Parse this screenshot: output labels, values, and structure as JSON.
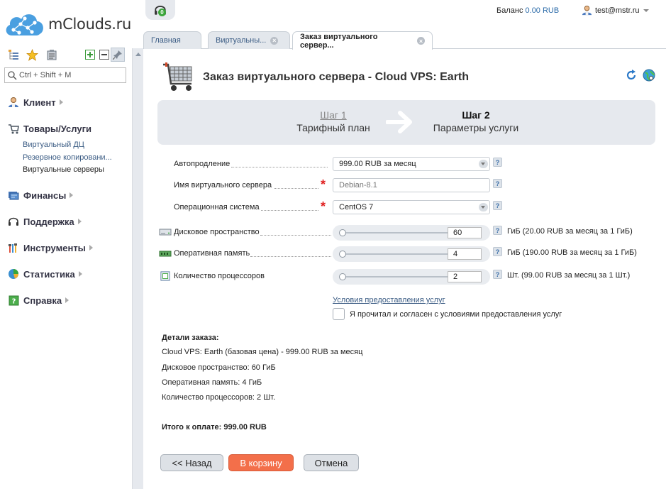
{
  "brand": {
    "logo_text": "mClouds.ru"
  },
  "search": {
    "placeholder": "Ctrl + Shift + M"
  },
  "topbar": {
    "headset_badge": "0",
    "balance_label": "Баланс",
    "balance_value": "0.00 RUB",
    "user": "test@mstr.ru"
  },
  "nav": {
    "client": "Клиент",
    "goods": "Товары/Услуги",
    "goods_sub": [
      "Виртуальный ДЦ",
      "Резервное копировани...",
      "Виртуальные серверы"
    ],
    "finance": "Финансы",
    "support": "Поддержка",
    "tools": "Инструменты",
    "stats": "Статистика",
    "help": "Справка"
  },
  "tabs": {
    "home": "Главная",
    "virtual": "Виртуальны...",
    "order": "Заказ виртуального сервер..."
  },
  "page": {
    "title": "Заказ виртуального сервера - Cloud VPS: Earth"
  },
  "steps": {
    "step1_title": "Шаг 1",
    "step1_sub": "Тарифный план",
    "step2_title": "Шаг 2",
    "step2_sub": "Параметры услуги"
  },
  "form": {
    "autorenew_label": "Автопродление",
    "autorenew_value": "999.00 RUB за месяц",
    "name_label": "Имя виртуального сервера",
    "name_placeholder": "Debian-8.1",
    "os_label": "Операционная система",
    "os_value": "CentOS 7",
    "disk_label": "Дисковое пространство",
    "disk_value": "60",
    "disk_unit": "ГиБ (20.00 RUB за месяц за 1 ГиБ)",
    "ram_label": "Оперативная память",
    "ram_value": "4",
    "ram_unit": "ГиБ (190.00 RUB за месяц за 1 ГиБ)",
    "cpu_label": "Количество процессоров",
    "cpu_value": "2",
    "cpu_unit": "Шт. (99.00 RUB за месяц за 1 Шт.)",
    "help_mark": "?",
    "required_mark": "*"
  },
  "terms": {
    "link": "Условия предоставления услуг",
    "agree": "Я прочитал и согласен с условиями предоставления услуг"
  },
  "details": {
    "title": "Детали заказа:",
    "lines": [
      "Cloud VPS: Earth (базовая цена) - 999.00 RUB за месяц",
      "Дисковое пространство: 60 ГиБ",
      "Оперативная память: 4 ГиБ",
      "Количество процессоров: 2 Шт."
    ],
    "total": "Итого к оплате: 999.00 RUB"
  },
  "buttons": {
    "back": "<< Назад",
    "cart": "В корзину",
    "cancel": "Отмена"
  },
  "colors": {
    "accent_orange": "#f36f4a",
    "link_blue": "#3b5c84",
    "panel_grey": "#e6e9ee",
    "required_red": "#e02020"
  }
}
